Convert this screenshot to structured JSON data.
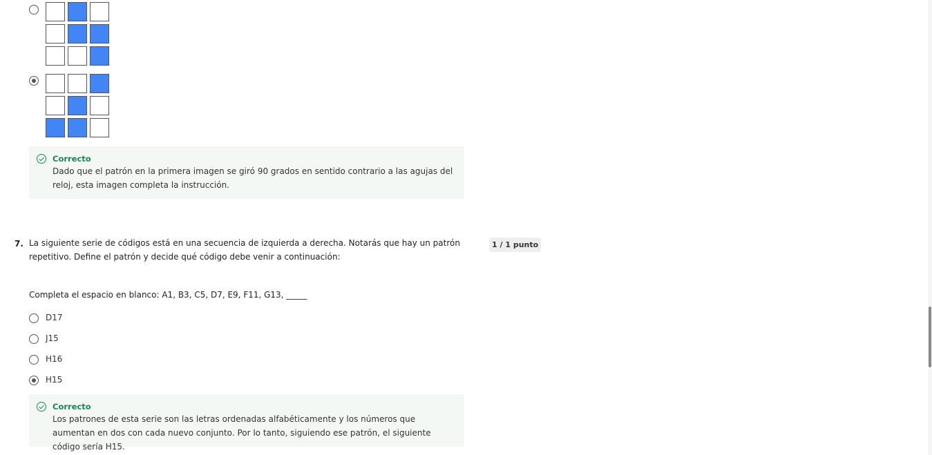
{
  "previous_question": {
    "options": [
      {
        "selected": false,
        "grid": [
          [
            0,
            1,
            0
          ],
          [
            0,
            1,
            1
          ],
          [
            0,
            0,
            1
          ]
        ]
      },
      {
        "selected": true,
        "grid": [
          [
            0,
            0,
            1
          ],
          [
            0,
            1,
            0
          ],
          [
            1,
            1,
            0
          ]
        ]
      }
    ],
    "feedback": {
      "title": "Correcto",
      "text": "Dado que el patrón en la primera imagen se giró 90 grados en sentido contrario a las agujas del reloj, esta imagen completa la instrucción."
    }
  },
  "question7": {
    "number": "7.",
    "prompt": "La siguiente serie de códigos está en una secuencia de izquierda a derecha. Notarás que hay un patrón repetitivo. Define el patrón y decide qué código debe venir a continuación:",
    "score": "1 / 1 punto",
    "instruction": "Completa el espacio en blanco: A1, B3, C5, D7, E9, F11, G13, _____",
    "options": [
      {
        "label": "D17",
        "selected": false
      },
      {
        "label": "J15",
        "selected": false
      },
      {
        "label": "H16",
        "selected": false
      },
      {
        "label": "H15",
        "selected": true
      }
    ],
    "feedback": {
      "title": "Correcto",
      "text": "Los patrones de esta serie son las letras ordenadas alfabéticamente y los números que aumentan en dos con cada nuevo conjunto. Por lo tanto, siguiendo ese patrón, el siguiente código sería H15."
    }
  },
  "colors": {
    "cell_filled": "#4285f4",
    "correct_green": "#1f8354",
    "feedback_bg": "#f3f8f5"
  }
}
